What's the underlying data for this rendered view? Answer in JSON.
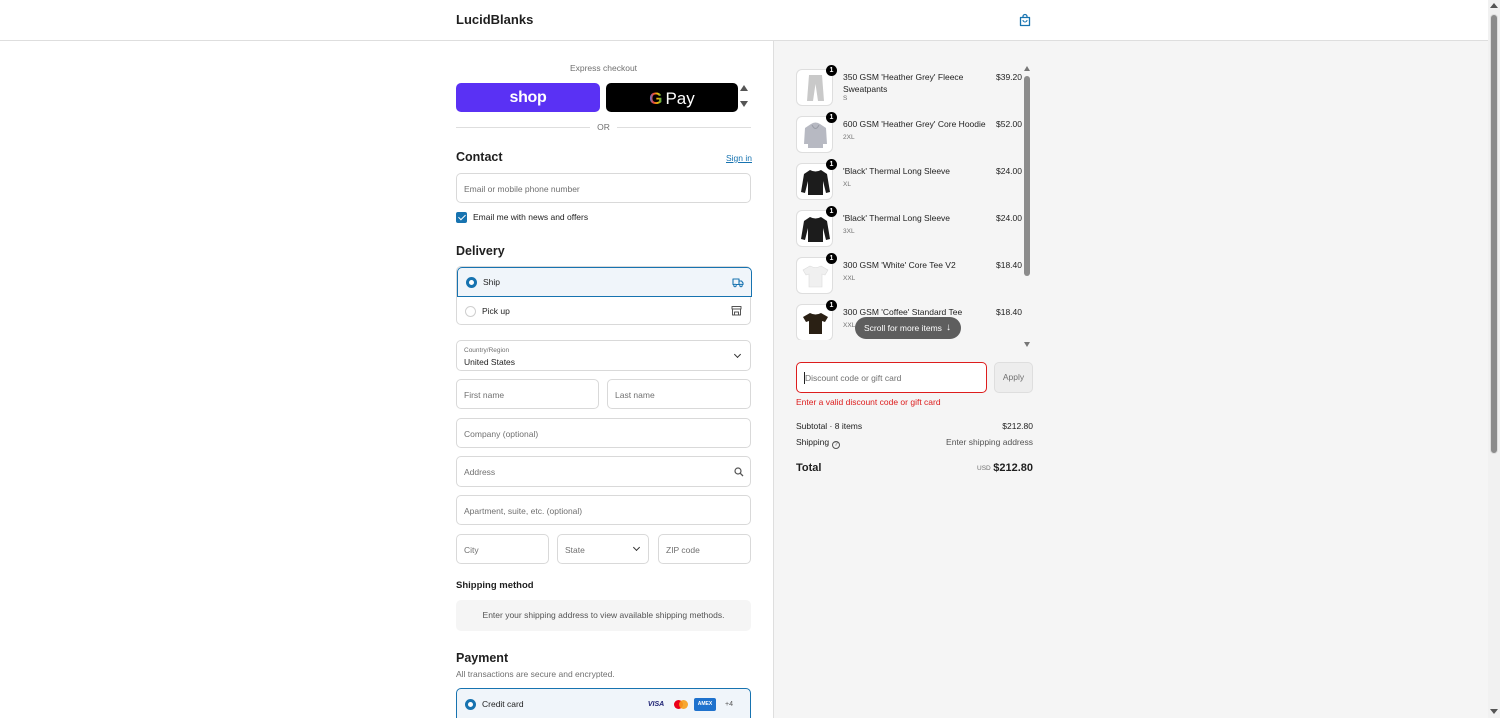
{
  "header": {
    "brand": "LucidBlanks",
    "bag_icon": "shopping-bag-icon"
  },
  "express": {
    "label": "Express checkout",
    "shop_label": "shop",
    "gpay_g": "G",
    "gpay_label": "Pay",
    "or_label": "OR"
  },
  "contact": {
    "title": "Contact",
    "sign_in": "Sign in",
    "email_placeholder": "Email or mobile phone number",
    "newsletter_label": "Email me with news and offers",
    "newsletter_checked": true
  },
  "delivery": {
    "title": "Delivery",
    "options": [
      {
        "label": "Ship",
        "selected": true,
        "icon": "truck-icon"
      },
      {
        "label": "Pick up",
        "selected": false,
        "icon": "store-icon"
      }
    ],
    "country_label": "Country/Region",
    "country_value": "United States",
    "first_name": "First name",
    "last_name": "Last name",
    "company": "Company (optional)",
    "address": "Address",
    "apartment": "Apartment, suite, etc. (optional)",
    "city": "City",
    "state": "State",
    "zip": "ZIP code"
  },
  "shipping_method": {
    "title": "Shipping method",
    "message": "Enter your shipping address to view available shipping methods."
  },
  "payment": {
    "title": "Payment",
    "subtitle": "All transactions are secure and encrypted.",
    "credit_card_label": "Credit card",
    "cards": [
      "VISA",
      "mastercard",
      "AMEX"
    ],
    "more_cards": "+4"
  },
  "summary": {
    "items": [
      {
        "qty": "1",
        "name": "350 GSM 'Heather Grey' Fleece Sweatpants",
        "variant": "S",
        "price": "$39.20"
      },
      {
        "qty": "1",
        "name": "600 GSM 'Heather Grey' Core Hoodie",
        "variant": "2XL",
        "price": "$52.00"
      },
      {
        "qty": "1",
        "name": "'Black' Thermal Long Sleeve",
        "variant": "XL",
        "price": "$24.00"
      },
      {
        "qty": "1",
        "name": "'Black' Thermal Long Sleeve",
        "variant": "3XL",
        "price": "$24.00"
      },
      {
        "qty": "1",
        "name": "300 GSM 'White' Core Tee V2",
        "variant": "XXL",
        "price": "$18.40"
      },
      {
        "qty": "1",
        "name": "300 GSM 'Coffee' Standard Tee",
        "variant": "XXL",
        "price": "$18.40"
      }
    ],
    "scroll_hint": "Scroll for more items",
    "discount_placeholder": "Discount code or gift card",
    "apply_label": "Apply",
    "discount_error": "Enter a valid discount code or gift card",
    "subtotal_label": "Subtotal · 8 items",
    "subtotal_value": "$212.80",
    "shipping_label": "Shipping",
    "shipping_value": "Enter shipping address",
    "total_label": "Total",
    "total_currency": "USD",
    "total_value": "$212.80"
  },
  "colors": {
    "accent": "#1773b0",
    "shop_purple": "#5a31f4",
    "error": "#dd1d1d",
    "summary_bg": "#f5f5f5"
  }
}
